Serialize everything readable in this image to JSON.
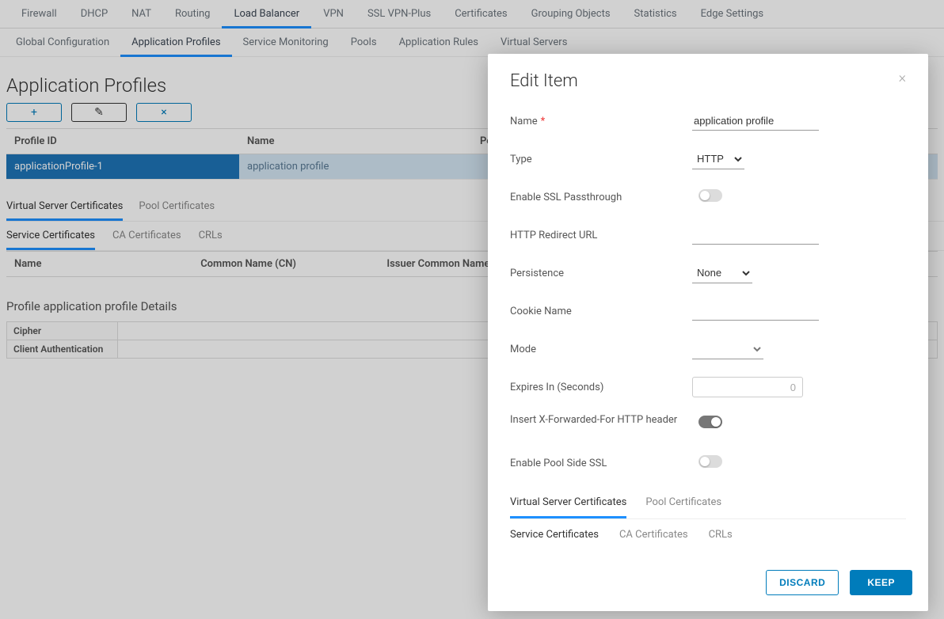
{
  "topnav": [
    {
      "label": "Firewall"
    },
    {
      "label": "DHCP"
    },
    {
      "label": "NAT"
    },
    {
      "label": "Routing"
    },
    {
      "label": "Load Balancer",
      "active": true
    },
    {
      "label": "VPN"
    },
    {
      "label": "SSL VPN-Plus"
    },
    {
      "label": "Certificates"
    },
    {
      "label": "Grouping Objects"
    },
    {
      "label": "Statistics"
    },
    {
      "label": "Edge Settings"
    }
  ],
  "subnav": [
    {
      "label": "Global Configuration"
    },
    {
      "label": "Application Profiles",
      "active": true
    },
    {
      "label": "Service Monitoring"
    },
    {
      "label": "Pools"
    },
    {
      "label": "Application Rules"
    },
    {
      "label": "Virtual Servers"
    }
  ],
  "section": {
    "title": "Application Profiles",
    "toolbar": {
      "add": "+",
      "edit": "✎",
      "delete": "×"
    },
    "columns": {
      "profile_id": "Profile ID",
      "name": "Name",
      "persistence": "Persistence"
    },
    "rows": [
      {
        "profile_id": "applicationProfile-1",
        "name": "application profile",
        "persistence": ""
      }
    ]
  },
  "cert_tabs": [
    {
      "label": "Virtual Server Certificates",
      "active": true
    },
    {
      "label": "Pool Certificates"
    }
  ],
  "cert_subtabs": [
    {
      "label": "Service Certificates",
      "active": true
    },
    {
      "label": "CA Certificates"
    },
    {
      "label": "CRLs"
    }
  ],
  "cert_columns": {
    "name": "Name",
    "cn": "Common Name (CN)",
    "issuer": "Issuer Common Name (CN)"
  },
  "details": {
    "title": "Profile application profile Details",
    "rows": [
      {
        "label": "Cipher",
        "value": ""
      },
      {
        "label": "Client Authentication",
        "value": ""
      }
    ]
  },
  "modal": {
    "title": "Edit Item",
    "fields": {
      "name": {
        "label": "Name",
        "required": true,
        "value": "application profile"
      },
      "type": {
        "label": "Type",
        "value": "HTTP"
      },
      "ssl_passthrough": {
        "label": "Enable SSL Passthrough",
        "on": false
      },
      "redirect": {
        "label": "HTTP Redirect URL",
        "value": ""
      },
      "persistence": {
        "label": "Persistence",
        "value": "None"
      },
      "cookie": {
        "label": "Cookie Name",
        "value": ""
      },
      "mode": {
        "label": "Mode",
        "value": ""
      },
      "expires": {
        "label": "Expires In (Seconds)",
        "value": "0"
      },
      "xff": {
        "label": "Insert X-Forwarded-For HTTP header",
        "on": true
      },
      "pool_ssl": {
        "label": "Enable Pool Side SSL",
        "on": false
      }
    },
    "tabs": [
      {
        "label": "Virtual Server Certificates",
        "active": true
      },
      {
        "label": "Pool Certificates"
      }
    ],
    "subtabs": [
      {
        "label": "Service Certificates",
        "active": true
      },
      {
        "label": "CA Certificates"
      },
      {
        "label": "CRLs"
      }
    ],
    "buttons": {
      "discard": "DISCARD",
      "keep": "KEEP"
    }
  }
}
